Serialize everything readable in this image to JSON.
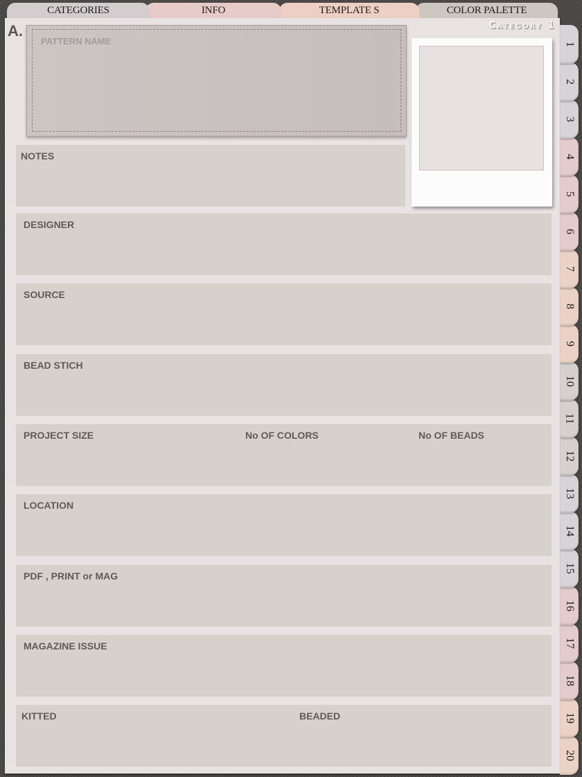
{
  "top_tabs": [
    {
      "label": "CATEGORIES",
      "color": "#d3cdd0"
    },
    {
      "label": "INFO",
      "color": "#e7cbc8"
    },
    {
      "label": "TEMPLATE S",
      "color": "#edd0c3"
    },
    {
      "label": "COLOR PALETTE",
      "color": "#cec6c1"
    }
  ],
  "page": {
    "section_letter": "A.",
    "category_title": "Category 1",
    "pattern_name_label": "PATTERN NAME",
    "photo_placeholder": "photo-frame"
  },
  "fields": {
    "notes": "NOTES",
    "designer": "DESIGNER",
    "source": "SOURCE",
    "bead_stich": "BEAD STICH",
    "project_size": "PROJECT SIZE",
    "no_of_colors": "No OF COLORS",
    "no_of_beads": "No OF BEADS",
    "location": "LOCATION",
    "pdf_print_mag": "PDF , PRINT or MAG",
    "magazine_issue": "MAGAZINE ISSUE",
    "kitted": "KITTED",
    "beaded": "BEADED"
  },
  "side_tabs": [
    {
      "label": "1",
      "color": "#d8d3d6"
    },
    {
      "label": "2",
      "color": "#d8d3d6"
    },
    {
      "label": "3",
      "color": "#d8d3d6"
    },
    {
      "label": "4",
      "color": "#e4cccc"
    },
    {
      "label": "5",
      "color": "#e4cccc"
    },
    {
      "label": "6",
      "color": "#e4cccc"
    },
    {
      "label": "7",
      "color": "#ead2c6"
    },
    {
      "label": "8",
      "color": "#ead2c6"
    },
    {
      "label": "9",
      "color": "#ead2c6"
    },
    {
      "label": "10",
      "color": "#d6d0ce"
    },
    {
      "label": "11",
      "color": "#d6d0ce"
    },
    {
      "label": "12",
      "color": "#d6d0ce"
    },
    {
      "label": "13",
      "color": "#d8d3d6"
    },
    {
      "label": "14",
      "color": "#d8d3d6"
    },
    {
      "label": "15",
      "color": "#d8d3d6"
    },
    {
      "label": "16",
      "color": "#e4cccc"
    },
    {
      "label": "17",
      "color": "#e4cccc"
    },
    {
      "label": "18",
      "color": "#e4cccc"
    },
    {
      "label": "19",
      "color": "#ead2c6"
    },
    {
      "label": "20",
      "color": "#ead2c6"
    }
  ]
}
